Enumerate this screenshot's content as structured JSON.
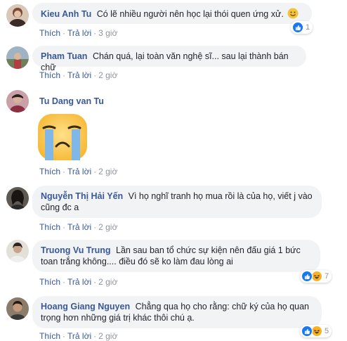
{
  "comments": [
    {
      "author": "Kieu Anh Tu",
      "text": "Có lẽ nhiều người nên học lại thói quen ứng xử.",
      "like": "Thích",
      "reply": "Trả lời",
      "time": "3 giờ",
      "reactions": {
        "icons": [
          "like-icon"
        ],
        "count": "1"
      },
      "colors": {
        "avatar": "#7a4b3a"
      }
    },
    {
      "author": "Pham Tuan",
      "text": "Chán quá, lại toàn văn nghệ sĩ... sau lại thành bán chữ",
      "like": "Thích",
      "reply": "Trả lời",
      "time": "2 giờ",
      "colors": {
        "avatar": "#5a6b7a"
      }
    },
    {
      "author": "Tu Dang van Tu",
      "sticker": "crying-face-sticker",
      "like": "Thích",
      "reply": "Trả lời",
      "time": "2 giờ",
      "colors": {
        "avatar": "#8a3040"
      }
    },
    {
      "author": "Nguyễn Thị Hải Yến",
      "text": "Vì họ nghĩ tranh họ mua rồi là của họ, viết j vào cũng đc a",
      "like": "Thích",
      "reply": "Trả lời",
      "time": "2 giờ",
      "colors": {
        "avatar": "#3a2a24"
      }
    },
    {
      "author": "Truong Vu Trung",
      "text": "Lần sau ban tổ chức sự kiện nên đấu giá 1 bức toan trắng không.... điều đó sẽ ko làm đau lòng ai",
      "like": "Thích",
      "reply": "Trả lời",
      "time": "2 giờ",
      "reactions": {
        "icons": [
          "like-icon",
          "haha-icon"
        ],
        "count": "7"
      },
      "colors": {
        "avatar": "#b8b2a2"
      }
    },
    {
      "author": "Hoang Giang Nguyen",
      "text": "Chẳng qua họ cho rằng: chữ ký của họ quan trọng hơn những giá trị khác thôi chú ạ.",
      "like": "Thích",
      "reply": "Trả lời",
      "time": "2 giờ",
      "reactions": {
        "icons": [
          "like-icon",
          "haha-icon"
        ],
        "count": "5"
      },
      "colors": {
        "avatar": "#4a3a30"
      }
    }
  ],
  "colors": {
    "link": "#385898",
    "bubble": "#f2f3f5",
    "like_blue": "#1877f2",
    "haha_yellow": "#f7b125"
  }
}
